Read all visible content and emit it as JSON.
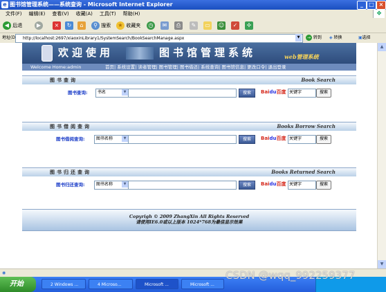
{
  "window": {
    "title": "图书馆管理系统——系统查询 - Microsoft Internet Explorer",
    "menu": [
      "文件(F)",
      "编辑(E)",
      "查看(V)",
      "收藏(A)",
      "工具(T)",
      "帮助(H)"
    ]
  },
  "toolbar": {
    "back": "后退",
    "search": "搜索",
    "favorites": "收藏夹"
  },
  "address": {
    "label": "地址(D)",
    "url": "http://localhost:2697/xiaoxinLibrary1/SystemSearch/BookSearchManage.aspx",
    "go": "转到",
    "convert": "转换",
    "select": "选择"
  },
  "banner": {
    "welcome": "欢迎使用",
    "system_name": "图书馆管理系统",
    "web_system": "web管理系统"
  },
  "nav": {
    "welcome": "Welcome Home:admin",
    "links": "首页| 系统设置| 读者管理| 图书管理| 图书借还| 系统查询| 图书馆信息| 更改口令| 退出登录"
  },
  "sections": [
    {
      "title_cn": "图书查询",
      "title_en": "Book Search",
      "label": "图书查询:",
      "select": "书名",
      "baidu_placeholder": "关键字",
      "search_btn": "搜索"
    },
    {
      "title_cn": "图书借阅查询",
      "title_en": "Books Borrow Search",
      "label": "图书借阅查询:",
      "select": "图书名称",
      "baidu_placeholder": "关键字",
      "search_btn": "搜索"
    },
    {
      "title_cn": "图书归还查询",
      "title_en": "Books Returned Search",
      "label": "图书归还查询:",
      "select": "图书名称",
      "baidu_placeholder": "关键字",
      "search_btn": "搜索"
    }
  ],
  "footer": {
    "copyright": "Copyrigh © 2009 ZhangXin   All Rights Reserved",
    "note": "请使用IE6.0或以上版本 1024*768为最佳显示效果"
  },
  "taskbar": {
    "start": "开始",
    "tasks": [
      "2 Windows ...",
      "4 Microso...",
      "Microsoft ...",
      "Microsoft ..."
    ]
  },
  "watermark": "CSDN @wqq_992259377"
}
